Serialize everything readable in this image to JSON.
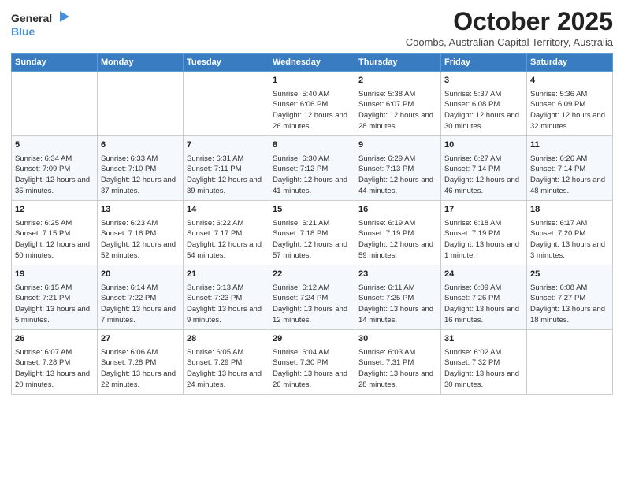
{
  "logo": {
    "line1": "General",
    "line2": "Blue",
    "icon_color": "#4a90d9"
  },
  "title": "October 2025",
  "subtitle": "Coombs, Australian Capital Territory, Australia",
  "days_of_week": [
    "Sunday",
    "Monday",
    "Tuesday",
    "Wednesday",
    "Thursday",
    "Friday",
    "Saturday"
  ],
  "weeks": [
    [
      {
        "day": "",
        "info": ""
      },
      {
        "day": "",
        "info": ""
      },
      {
        "day": "",
        "info": ""
      },
      {
        "day": "1",
        "info": "Sunrise: 5:40 AM\nSunset: 6:06 PM\nDaylight: 12 hours\nand 26 minutes."
      },
      {
        "day": "2",
        "info": "Sunrise: 5:38 AM\nSunset: 6:07 PM\nDaylight: 12 hours\nand 28 minutes."
      },
      {
        "day": "3",
        "info": "Sunrise: 5:37 AM\nSunset: 6:08 PM\nDaylight: 12 hours\nand 30 minutes."
      },
      {
        "day": "4",
        "info": "Sunrise: 5:36 AM\nSunset: 6:09 PM\nDaylight: 12 hours\nand 32 minutes."
      }
    ],
    [
      {
        "day": "5",
        "info": "Sunrise: 6:34 AM\nSunset: 7:09 PM\nDaylight: 12 hours\nand 35 minutes."
      },
      {
        "day": "6",
        "info": "Sunrise: 6:33 AM\nSunset: 7:10 PM\nDaylight: 12 hours\nand 37 minutes."
      },
      {
        "day": "7",
        "info": "Sunrise: 6:31 AM\nSunset: 7:11 PM\nDaylight: 12 hours\nand 39 minutes."
      },
      {
        "day": "8",
        "info": "Sunrise: 6:30 AM\nSunset: 7:12 PM\nDaylight: 12 hours\nand 41 minutes."
      },
      {
        "day": "9",
        "info": "Sunrise: 6:29 AM\nSunset: 7:13 PM\nDaylight: 12 hours\nand 44 minutes."
      },
      {
        "day": "10",
        "info": "Sunrise: 6:27 AM\nSunset: 7:14 PM\nDaylight: 12 hours\nand 46 minutes."
      },
      {
        "day": "11",
        "info": "Sunrise: 6:26 AM\nSunset: 7:14 PM\nDaylight: 12 hours\nand 48 minutes."
      }
    ],
    [
      {
        "day": "12",
        "info": "Sunrise: 6:25 AM\nSunset: 7:15 PM\nDaylight: 12 hours\nand 50 minutes."
      },
      {
        "day": "13",
        "info": "Sunrise: 6:23 AM\nSunset: 7:16 PM\nDaylight: 12 hours\nand 52 minutes."
      },
      {
        "day": "14",
        "info": "Sunrise: 6:22 AM\nSunset: 7:17 PM\nDaylight: 12 hours\nand 54 minutes."
      },
      {
        "day": "15",
        "info": "Sunrise: 6:21 AM\nSunset: 7:18 PM\nDaylight: 12 hours\nand 57 minutes."
      },
      {
        "day": "16",
        "info": "Sunrise: 6:19 AM\nSunset: 7:19 PM\nDaylight: 12 hours\nand 59 minutes."
      },
      {
        "day": "17",
        "info": "Sunrise: 6:18 AM\nSunset: 7:19 PM\nDaylight: 13 hours\nand 1 minute."
      },
      {
        "day": "18",
        "info": "Sunrise: 6:17 AM\nSunset: 7:20 PM\nDaylight: 13 hours\nand 3 minutes."
      }
    ],
    [
      {
        "day": "19",
        "info": "Sunrise: 6:15 AM\nSunset: 7:21 PM\nDaylight: 13 hours\nand 5 minutes."
      },
      {
        "day": "20",
        "info": "Sunrise: 6:14 AM\nSunset: 7:22 PM\nDaylight: 13 hours\nand 7 minutes."
      },
      {
        "day": "21",
        "info": "Sunrise: 6:13 AM\nSunset: 7:23 PM\nDaylight: 13 hours\nand 9 minutes."
      },
      {
        "day": "22",
        "info": "Sunrise: 6:12 AM\nSunset: 7:24 PM\nDaylight: 13 hours\nand 12 minutes."
      },
      {
        "day": "23",
        "info": "Sunrise: 6:11 AM\nSunset: 7:25 PM\nDaylight: 13 hours\nand 14 minutes."
      },
      {
        "day": "24",
        "info": "Sunrise: 6:09 AM\nSunset: 7:26 PM\nDaylight: 13 hours\nand 16 minutes."
      },
      {
        "day": "25",
        "info": "Sunrise: 6:08 AM\nSunset: 7:27 PM\nDaylight: 13 hours\nand 18 minutes."
      }
    ],
    [
      {
        "day": "26",
        "info": "Sunrise: 6:07 AM\nSunset: 7:28 PM\nDaylight: 13 hours\nand 20 minutes."
      },
      {
        "day": "27",
        "info": "Sunrise: 6:06 AM\nSunset: 7:28 PM\nDaylight: 13 hours\nand 22 minutes."
      },
      {
        "day": "28",
        "info": "Sunrise: 6:05 AM\nSunset: 7:29 PM\nDaylight: 13 hours\nand 24 minutes."
      },
      {
        "day": "29",
        "info": "Sunrise: 6:04 AM\nSunset: 7:30 PM\nDaylight: 13 hours\nand 26 minutes."
      },
      {
        "day": "30",
        "info": "Sunrise: 6:03 AM\nSunset: 7:31 PM\nDaylight: 13 hours\nand 28 minutes."
      },
      {
        "day": "31",
        "info": "Sunrise: 6:02 AM\nSunset: 7:32 PM\nDaylight: 13 hours\nand 30 minutes."
      },
      {
        "day": "",
        "info": ""
      }
    ]
  ]
}
